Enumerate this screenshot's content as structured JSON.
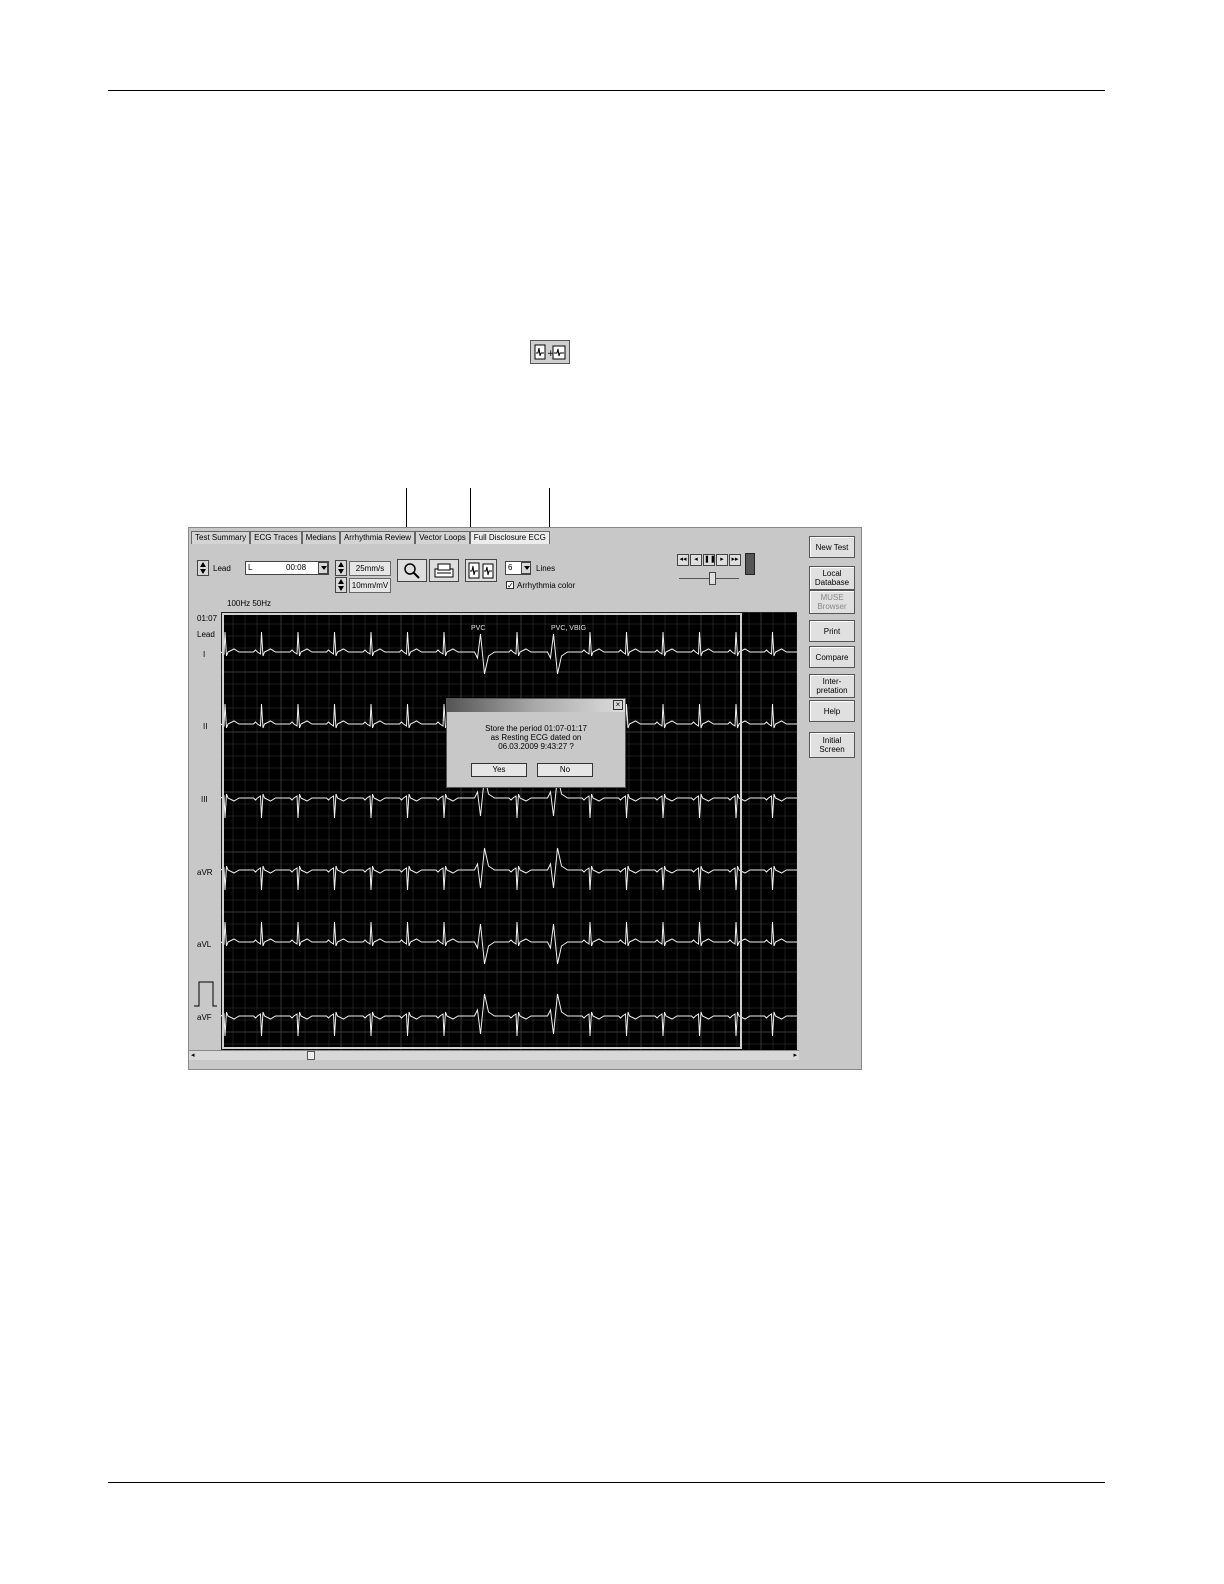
{
  "tabs": [
    "Test Summary",
    "ECG Traces",
    "Medians",
    "Arrhythmia Review",
    "Vector Loops",
    "Full Disclosure ECG"
  ],
  "side_buttons": [
    "New Test",
    "Local Database",
    "MUSE Browser",
    "Print",
    "Compare",
    "Inter- pretation",
    "Help",
    "Initial Screen"
  ],
  "controls": {
    "lead_label": "Lead",
    "lead_value": "L",
    "time_value": "00:08",
    "speed": "25mm/s",
    "gain": "10mm/mV",
    "lines_value": "6",
    "lines_label": "Lines",
    "arrhythmia_color": "Arrhythmia color",
    "filter_info": "100Hz 50Hz",
    "time_position": "01:07",
    "lead_column": "Lead"
  },
  "leads": [
    "I",
    "II",
    "III",
    "aVR",
    "aVL",
    "aVF"
  ],
  "annotations": [
    "PVC",
    "PVC, VBIG"
  ],
  "dialog": {
    "line1": "Store the period 01:07-01:17",
    "line2": "as Resting ECG dated on",
    "line3": "06.03.2009 9:43:27 ?",
    "yes": "Yes",
    "no": "No"
  }
}
